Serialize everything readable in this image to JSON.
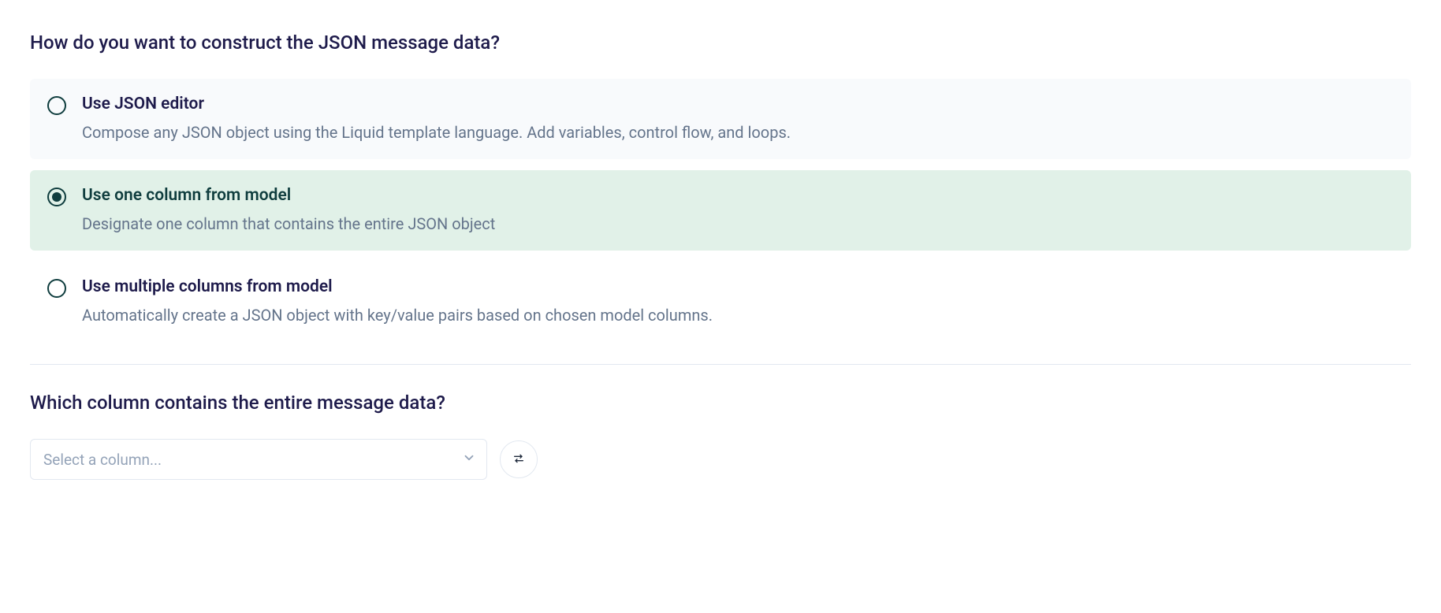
{
  "heading1": "How do you want to construct the JSON message data?",
  "options": [
    {
      "title": "Use JSON editor",
      "description": "Compose any JSON object using the Liquid template language. Add variables, control flow, and loops.",
      "selected": false,
      "style": "default"
    },
    {
      "title": "Use one column from model",
      "description": "Designate one column that contains the entire JSON object",
      "selected": true,
      "style": "selected"
    },
    {
      "title": "Use multiple columns from model",
      "description": "Automatically create a JSON object with key/value pairs based on chosen model columns.",
      "selected": false,
      "style": "plain"
    }
  ],
  "heading2": "Which column contains the entire message data?",
  "select": {
    "placeholder": "Select a column..."
  }
}
